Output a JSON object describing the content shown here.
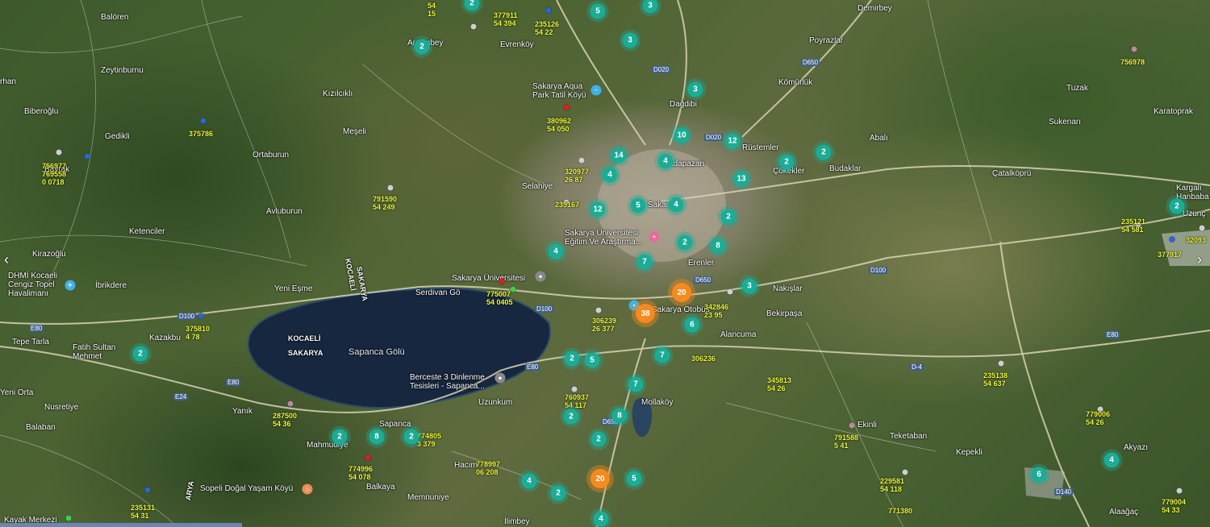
{
  "colors": {
    "cluster_small": "#1bac96",
    "cluster_large": "#f58a1f",
    "code_label": "#f2ff3a",
    "lake": "#1a2a44"
  },
  "controls": {
    "prev_icon": "chevron-left-icon",
    "next_icon": "chevron-right-icon",
    "prev_glyph": "‹",
    "next_glyph": "›"
  },
  "places": [
    {
      "id": "baloren",
      "text": "Balören"
    },
    {
      "id": "arslanbey",
      "text": "Arslanbey"
    },
    {
      "id": "zeytinburnu",
      "text": "Zeytinburnu"
    },
    {
      "id": "erhan",
      "text": "rhan"
    },
    {
      "id": "kizilcikli",
      "text": "Kızılcıklı"
    },
    {
      "id": "biberoglu",
      "text": "Biberoğlu"
    },
    {
      "id": "gedikli",
      "text": "Gedikli"
    },
    {
      "id": "mesel",
      "text": "Meşeli"
    },
    {
      "id": "ortaburun",
      "text": "Ortaburun"
    },
    {
      "id": "bayraktar",
      "text": "Bayrak"
    },
    {
      "id": "avluburun",
      "text": "Avluburun"
    },
    {
      "id": "ketenciler",
      "text": "Ketenciler"
    },
    {
      "id": "kirazoglu",
      "text": "Kirazoğlu"
    },
    {
      "id": "havalimani",
      "text": "DHMİ Kocaeli Cengiz Topel Havalimanı"
    },
    {
      "id": "ibrikdere",
      "text": "İbrikdere"
    },
    {
      "id": "yenieşme",
      "text": "Yeni Eşme"
    },
    {
      "id": "kazakburun",
      "text": "Kazakbu"
    },
    {
      "id": "tepetarla",
      "text": "Tepe Tarla"
    },
    {
      "id": "fatih",
      "text": "Fatih Sultan Mehmet"
    },
    {
      "id": "yeniorta",
      "text": "Yeni Orta"
    },
    {
      "id": "nusretiye",
      "text": "Nusretiye"
    },
    {
      "id": "yanik",
      "text": "Yanık"
    },
    {
      "id": "balaban",
      "text": "Balaban"
    },
    {
      "id": "mahmudiye",
      "text": "Mahmudiye"
    },
    {
      "id": "sapanca",
      "text": "Sapanca"
    },
    {
      "id": "balkaya",
      "text": "Balkaya"
    },
    {
      "id": "sopeli",
      "text": "Sopeli Doğal Yaşam Köyü"
    },
    {
      "id": "kayak",
      "text": "Kayak Merkezi"
    },
    {
      "id": "memnuniye",
      "text": "Memnuniye"
    },
    {
      "id": "hacimehmet",
      "text": "Hacım"
    },
    {
      "id": "uzunkum",
      "text": "Uzunkum"
    },
    {
      "id": "berceste",
      "text": "Berceste 3 Dinlenme Tesisleri - Sapanca..."
    },
    {
      "id": "sapancagolu",
      "text": "Sapanca Gölü"
    },
    {
      "id": "serdivan",
      "text": "Serdivan Gö"
    },
    {
      "id": "sakaryauni",
      "text": "Sakarya Üniversitesi"
    },
    {
      "id": "sakaryauni2",
      "text": "Sakarya Üniversitesi Eğitim Ve Araştırma..."
    },
    {
      "id": "selahiye",
      "text": "Selahiye"
    },
    {
      "id": "evrenkoy",
      "text": "Evrenköy"
    },
    {
      "id": "aquapark",
      "text": "Sakarya Aqua Park Tatil Köyü"
    },
    {
      "id": "dagdibi",
      "text": "Dağdibi"
    },
    {
      "id": "adapazari",
      "text": "Adapazarı"
    },
    {
      "id": "sakarya",
      "text": "Sakarya"
    },
    {
      "id": "erenler",
      "text": "Erenler"
    },
    {
      "id": "otobus",
      "text": "Sakarya Otobüs"
    },
    {
      "id": "alancuma",
      "text": "Alancuma"
    },
    {
      "id": "bekirpasa",
      "text": "Bekirpaşa"
    },
    {
      "id": "naksilar",
      "text": "Nakışlar"
    },
    {
      "id": "mollakoy",
      "text": "Mollaköy"
    },
    {
      "id": "ilimbey",
      "text": "İlimbey"
    },
    {
      "id": "ekinli",
      "text": "Ekinli"
    },
    {
      "id": "teketaban",
      "text": "Teketaban"
    },
    {
      "id": "kepekli",
      "text": "Kepekli"
    },
    {
      "id": "akyazi",
      "text": "Akyazı"
    },
    {
      "id": "alaagac",
      "text": "Alaağaç"
    },
    {
      "id": "poyrazlar",
      "text": "Poyrazlar"
    },
    {
      "id": "komurluk",
      "text": "Kömürlük"
    },
    {
      "id": "demirbey",
      "text": "Demirbey"
    },
    {
      "id": "rustemler",
      "text": "Rüstemler"
    },
    {
      "id": "cokekler",
      "text": "Çökekler"
    },
    {
      "id": "budaklar",
      "text": "Budaklar"
    },
    {
      "id": "abali",
      "text": "Abalı"
    },
    {
      "id": "catalkopru",
      "text": "Çatalköprü"
    },
    {
      "id": "sukenari",
      "text": "Sukenarı"
    },
    {
      "id": "tuzak",
      "text": "Tuzak"
    },
    {
      "id": "karatoprak",
      "text": "Karatoprak"
    },
    {
      "id": "kargali",
      "text": "Kargalı Hanbaba"
    },
    {
      "id": "uzunc",
      "text": "Uzunç"
    },
    {
      "id": "kocaeli1",
      "text": "KOCAELİ"
    },
    {
      "id": "sakarya1",
      "text": "SAKARYA"
    },
    {
      "id": "sakaryavert",
      "text": "SAKARYA"
    },
    {
      "id": "kocaelivert",
      "text": "KOCAELİ"
    },
    {
      "id": "yanikarya",
      "text": "ARYA"
    }
  ],
  "road_labels": [
    {
      "id": "d020a",
      "text": "D020"
    },
    {
      "id": "d020b",
      "text": "D020"
    },
    {
      "id": "d650a",
      "text": "D650"
    },
    {
      "id": "d650b",
      "text": "D650"
    },
    {
      "id": "d100a",
      "text": "D100"
    },
    {
      "id": "d100b",
      "text": "D100"
    },
    {
      "id": "d100c",
      "text": "D100"
    },
    {
      "id": "e80a",
      "text": "E80"
    },
    {
      "id": "e80b",
      "text": "E80"
    },
    {
      "id": "e80c",
      "text": "E80"
    },
    {
      "id": "e80d",
      "text": "E80"
    },
    {
      "id": "e24",
      "text": "E24"
    },
    {
      "id": "d4",
      "text": "D-4"
    },
    {
      "id": "d140",
      "text": "D140"
    },
    {
      "id": "d650c",
      "text": "D650"
    }
  ],
  "clusters": [
    {
      "id": "c1",
      "count": "2"
    },
    {
      "id": "c2",
      "count": "2"
    },
    {
      "id": "c3",
      "count": "5"
    },
    {
      "id": "c4",
      "count": "3"
    },
    {
      "id": "c5",
      "count": "3"
    },
    {
      "id": "c6",
      "count": "3"
    },
    {
      "id": "c7",
      "count": "10"
    },
    {
      "id": "c8",
      "count": "12"
    },
    {
      "id": "c9",
      "count": "14"
    },
    {
      "id": "c10",
      "count": "4"
    },
    {
      "id": "c11",
      "count": "4"
    },
    {
      "id": "c12",
      "count": "2"
    },
    {
      "id": "c13",
      "count": "2"
    },
    {
      "id": "c14",
      "count": "13"
    },
    {
      "id": "c15",
      "count": "12"
    },
    {
      "id": "c16",
      "count": "5"
    },
    {
      "id": "c17",
      "count": "4"
    },
    {
      "id": "c18",
      "count": "2"
    },
    {
      "id": "c19",
      "count": "2"
    },
    {
      "id": "c20",
      "count": "8"
    },
    {
      "id": "c21",
      "count": "4"
    },
    {
      "id": "c22",
      "count": "7"
    },
    {
      "id": "c23",
      "count": "20",
      "size": "large"
    },
    {
      "id": "c24",
      "count": "3"
    },
    {
      "id": "c25",
      "count": "38",
      "size": "large"
    },
    {
      "id": "c26",
      "count": "6"
    },
    {
      "id": "c27",
      "count": "7"
    },
    {
      "id": "c28",
      "count": "2"
    },
    {
      "id": "c29",
      "count": "5"
    },
    {
      "id": "c30",
      "count": "7"
    },
    {
      "id": "c31",
      "count": "2"
    },
    {
      "id": "c32",
      "count": "8"
    },
    {
      "id": "c33",
      "count": "2"
    },
    {
      "id": "c34",
      "count": "2"
    },
    {
      "id": "c35",
      "count": "8"
    },
    {
      "id": "c36",
      "count": "2"
    },
    {
      "id": "c37",
      "count": "20",
      "size": "large"
    },
    {
      "id": "c38",
      "count": "4"
    },
    {
      "id": "c39",
      "count": "5"
    },
    {
      "id": "c40",
      "count": "2"
    },
    {
      "id": "c41",
      "count": "4"
    },
    {
      "id": "c42",
      "count": "6"
    },
    {
      "id": "c43",
      "count": "4"
    },
    {
      "id": "c44",
      "count": "2"
    },
    {
      "id": "c45",
      "count": "2"
    }
  ],
  "codes": [
    {
      "id": "k1",
      "lines": [
        "54",
        "15"
      ]
    },
    {
      "id": "k2",
      "lines": [
        "377911",
        "54 394"
      ]
    },
    {
      "id": "k3",
      "lines": [
        "235126",
        "54 22"
      ]
    },
    {
      "id": "k4",
      "lines": [
        "375786"
      ]
    },
    {
      "id": "k5",
      "lines": [
        "756977",
        "769558",
        "0 0718"
      ]
    },
    {
      "id": "k6",
      "lines": [
        "380962",
        "54 050"
      ]
    },
    {
      "id": "k7",
      "lines": [
        "320977",
        "26 87"
      ]
    },
    {
      "id": "k8",
      "lines": [
        "791590",
        "54 249"
      ]
    },
    {
      "id": "k9",
      "lines": [
        "235167"
      ]
    },
    {
      "id": "k10",
      "lines": [
        "775007",
        "54 0405"
      ]
    },
    {
      "id": "k11",
      "lines": [
        "306239",
        "26 377"
      ]
    },
    {
      "id": "k12",
      "lines": [
        "342846",
        "23 95"
      ]
    },
    {
      "id": "k13",
      "lines": [
        "375810",
        "4 78"
      ]
    },
    {
      "id": "k14",
      "lines": [
        "306236"
      ]
    },
    {
      "id": "k15",
      "lines": [
        "345813",
        "54 26"
      ]
    },
    {
      "id": "k16",
      "lines": [
        "760937",
        "54 117"
      ]
    },
    {
      "id": "k17",
      "lines": [
        "287500",
        "54 36"
      ]
    },
    {
      "id": "k18",
      "lines": [
        "774805",
        "3 379"
      ]
    },
    {
      "id": "k19",
      "lines": [
        "774996",
        "54 078"
      ]
    },
    {
      "id": "k20",
      "lines": [
        "778997",
        "06 208"
      ]
    },
    {
      "id": "k21",
      "lines": [
        "791588",
        "5 41"
      ]
    },
    {
      "id": "k22",
      "lines": [
        "229581",
        "54 118"
      ]
    },
    {
      "id": "k23",
      "lines": [
        "771380"
      ]
    },
    {
      "id": "k24",
      "lines": [
        "235138",
        "54 637"
      ]
    },
    {
      "id": "k25",
      "lines": [
        "779006",
        "54 26"
      ]
    },
    {
      "id": "k26",
      "lines": [
        "756978"
      ]
    },
    {
      "id": "k27",
      "lines": [
        "235121",
        "54 581"
      ]
    },
    {
      "id": "k28",
      "lines": [
        "377917"
      ]
    },
    {
      "id": "k29",
      "lines": [
        "32093"
      ]
    },
    {
      "id": "k30",
      "lines": [
        "779004",
        "54 33"
      ]
    },
    {
      "id": "k31",
      "lines": [
        "235131",
        "54 31"
      ]
    }
  ]
}
